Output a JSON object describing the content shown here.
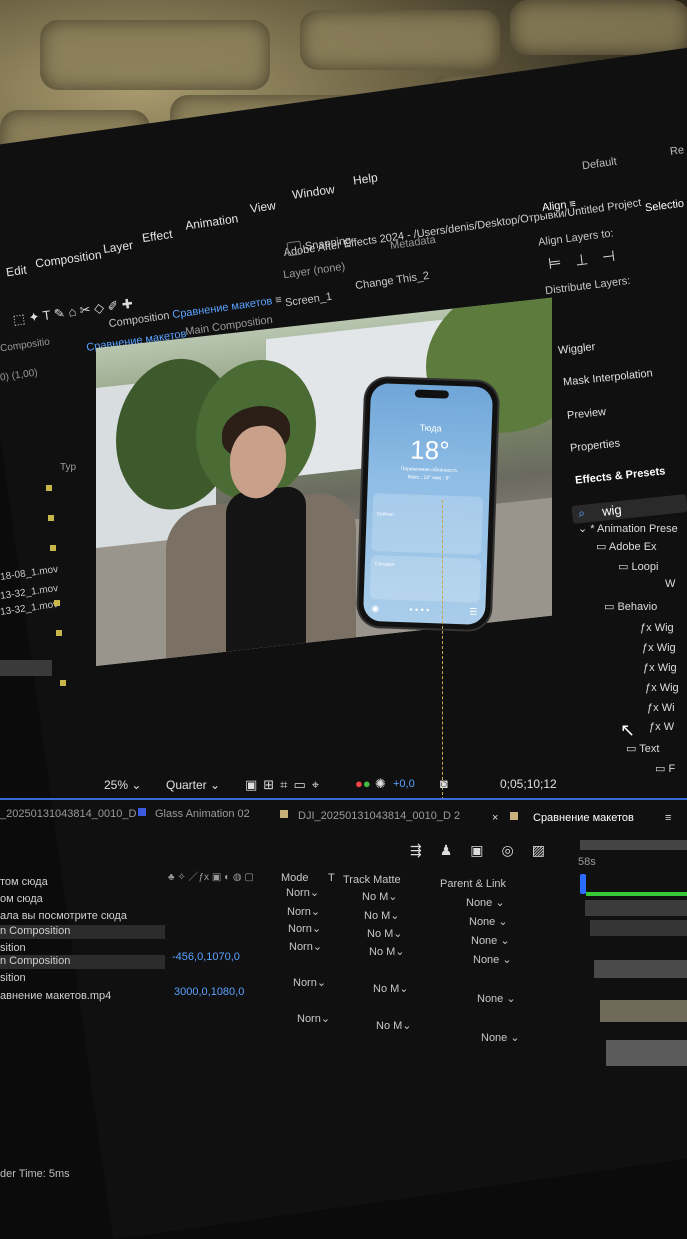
{
  "menu": {
    "items": [
      "Edit",
      "Composition",
      "Layer",
      "Effect",
      "Animation",
      "View",
      "Window",
      "Help"
    ],
    "app_title": "Adobe After Effects 2024 - /Users/denis/Desktop/Отрывки/Untitled Project",
    "workspace": "Default",
    "workspace_more": "Re"
  },
  "toolbar": {
    "snapping": "Snapping",
    "composition_tab_prefix": "Composition",
    "composition_name": "Сравнение макетов",
    "layer_label": "Layer (none)",
    "metadata": "Metadata"
  },
  "comp_nav": {
    "active": "Сравнение макетов",
    "main": "Main Composition",
    "screen": "Screen_1",
    "change": "Change This_2"
  },
  "project": {
    "label": "Compositio",
    "info": "0) (1,00)",
    "type_header": "Typ",
    "files": [
      "18-08_1.mov",
      "13-32_1.mov",
      "13-32_1.mov"
    ]
  },
  "viewer_bar": {
    "zoom": "25%",
    "resolution": "Quarter",
    "exposure": "+0,0",
    "timecode": "0;05;10;12"
  },
  "phone": {
    "city": "Тюда",
    "temp": "18°",
    "condition": "Переменная облачность",
    "minmax": "Макс.: 19° мин.: 9°",
    "today": "Сегодня",
    "now": "Сейчас"
  },
  "right_panel": {
    "align_title": "Align",
    "selection": "Selectio",
    "align_layers_to": "Align Layers to:",
    "distribute_layers": "Distribute Layers:",
    "panels": [
      "Wiggler",
      "Mask Interpolation",
      "Preview",
      "Properties"
    ],
    "effects_presets": "Effects & Presets",
    "search_value": "wig",
    "tree": [
      {
        "label": "* Animation Prese",
        "indent": 0
      },
      {
        "label": "Adobe Ex",
        "indent": 1
      },
      {
        "label": "Loopi",
        "indent": 2
      },
      {
        "label": "W",
        "indent": 3
      },
      {
        "label": "Behavio",
        "indent": 1
      },
      {
        "label": "Wig",
        "indent": 2
      },
      {
        "label": "Wig",
        "indent": 2
      },
      {
        "label": "Wig",
        "indent": 2
      },
      {
        "label": "Wig",
        "indent": 2
      },
      {
        "label": "Wi",
        "indent": 2
      },
      {
        "label": "W",
        "indent": 2
      },
      {
        "label": "Text",
        "indent": 1
      },
      {
        "label": "F",
        "indent": 2
      }
    ]
  },
  "timeline": {
    "tabs": [
      "_20250131043814_0010_D",
      "Glass Animation 02",
      "DJI_20250131043814_0010_D 2",
      "Сравнение макетов"
    ],
    "time_marker": "58s",
    "headers": {
      "mode": "Mode",
      "t": "T",
      "track_matte": "Track Matte",
      "parent": "Parent & Link"
    },
    "layers": [
      {
        "name": "том сюда",
        "mode": "Norn",
        "matte": "No M",
        "parent": "None"
      },
      {
        "name": "ом сюда",
        "mode": "Norn",
        "matte": "No M",
        "parent": "None"
      },
      {
        "name": "ала вы посмотрите сюда",
        "mode": "Norn",
        "matte": "No M",
        "parent": "None"
      },
      {
        "name": "n Composition",
        "mode": "Norn",
        "matte": "No M",
        "parent": "None"
      },
      {
        "name": "n Composition",
        "mode": "",
        "matte": "",
        "parent": ""
      },
      {
        "name": "авнение макетов.mp4",
        "mode": "Norn",
        "matte": "No M",
        "parent": "None"
      },
      {
        "name": "",
        "mode": "Norn",
        "matte": "No M",
        "parent": "None"
      }
    ],
    "position_1": "-456,0,1070,0",
    "position_2": "3000,0,1080,0",
    "sition_label": "sition",
    "footer": "der Time: 5ms"
  }
}
